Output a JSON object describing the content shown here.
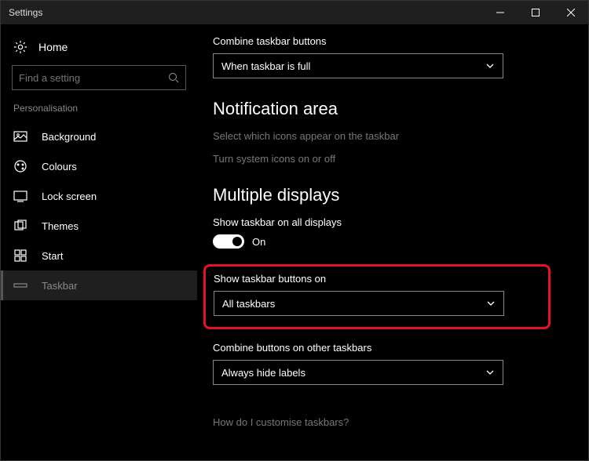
{
  "window": {
    "title": "Settings"
  },
  "sidebar": {
    "home": "Home",
    "search_placeholder": "Find a setting",
    "category": "Personalisation",
    "items": [
      {
        "label": "Background"
      },
      {
        "label": "Colours"
      },
      {
        "label": "Lock screen"
      },
      {
        "label": "Themes"
      },
      {
        "label": "Start"
      },
      {
        "label": "Taskbar"
      }
    ]
  },
  "main": {
    "combine_label": "Combine taskbar buttons",
    "combine_value": "When taskbar is full",
    "section_notification": "Notification area",
    "link_select_icons": "Select which icons appear on the taskbar",
    "link_system_icons": "Turn system icons on or off",
    "section_multiple": "Multiple displays",
    "show_all_label": "Show taskbar on all displays",
    "toggle_on_text": "On",
    "show_buttons_label": "Show taskbar buttons on",
    "show_buttons_value": "All taskbars",
    "combine_other_label": "Combine buttons on other taskbars",
    "combine_other_value": "Always hide labels",
    "footer_link": "How do I customise taskbars?"
  }
}
